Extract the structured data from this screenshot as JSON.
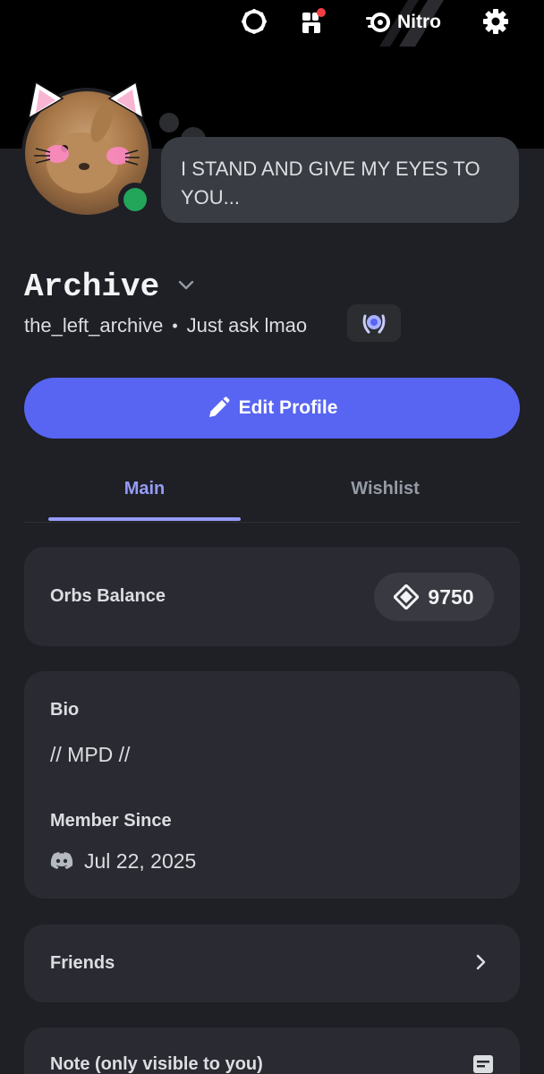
{
  "header": {
    "nitro_label": "Nitro"
  },
  "profile": {
    "status_bubble": "I STAND AND GIVE MY EYES TO YOU...",
    "display_name": "Archive",
    "username": "the_left_archive",
    "separator": "•",
    "pronouns": "Just ask lmao",
    "online_status_color": "#23a55a"
  },
  "actions": {
    "edit_profile_label": "Edit Profile"
  },
  "tabs": [
    {
      "label": "Main",
      "active": true
    },
    {
      "label": "Wishlist",
      "active": false
    }
  ],
  "orbs": {
    "label": "Orbs Balance",
    "value": "9750"
  },
  "about": {
    "bio_label": "Bio",
    "bio_text": "// MPD //",
    "member_since_label": "Member Since",
    "member_since_date": "Jul 22, 2025"
  },
  "friends": {
    "label": "Friends"
  },
  "note": {
    "label": "Note (only visible to you)"
  },
  "colors": {
    "accent": "#5865f2",
    "tab_active": "#949cf7",
    "background": "#1f1f26",
    "card": "#2a2b32"
  },
  "icons": [
    "quest-icon",
    "shop-icon",
    "nitro-icon",
    "gear-icon",
    "pencil-icon",
    "orb-icon",
    "discord-icon",
    "chevron-right-icon",
    "note-icon",
    "chevron-down-icon",
    "laurel-badge-icon"
  ]
}
